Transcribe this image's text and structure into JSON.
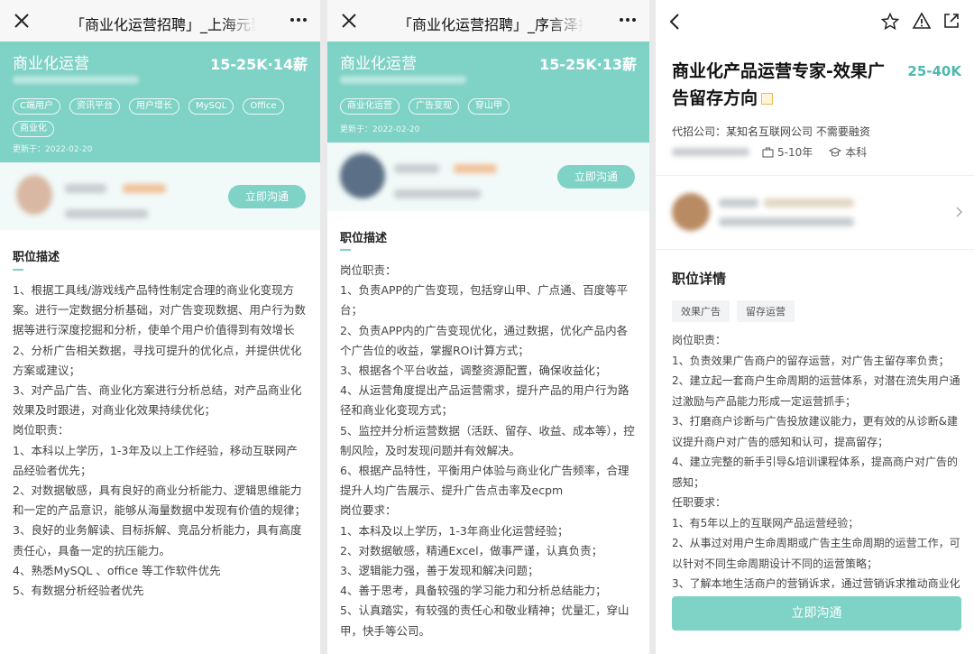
{
  "colors": {
    "accent": "#7fd2c6",
    "accent_text": "#4fb9ad"
  },
  "panel1": {
    "nav_title": "「商业化运营招聘」_上海元聚推",
    "job_title": "商业化运营",
    "salary": "15-25K·14薪",
    "tags": [
      "C端用户",
      "资讯平台",
      "用户增长",
      "MySQL",
      "Office",
      "商业化"
    ],
    "updated": "更新于：2022-02-20",
    "chat_label": "立即沟通",
    "section_title": "职位描述",
    "desc": [
      "1、根据工具线/游戏线产品特性制定合理的商业化变现方案。进行一定数据分析基础，对广告变现数据、用户行为数据等进行深度挖掘和分析，使单个用户价值得到有效增长",
      "2、分析广告相关数据，寻找可提升的优化点，并提供优化方案或建议；",
      "3、对产品广告、商业化方案进行分析总结，对产品商业化效果及时跟进，对商业化效果持续优化；",
      "岗位职责：",
      "1、本科以上学历，1-3年及以上工作经验，移动互联网产品经验者优先；",
      "2、对数据敏感，具有良好的商业分析能力、逻辑思维能力和一定的产品意识，能够从海量数据中发现有价值的规律；",
      "3、良好的业务解读、目标拆解、竞品分析能力，具有高度责任心，具备一定的抗压能力。",
      "4、熟悉MySQL 、office 等工作软件优先",
      "5、有数据分析经验者优先"
    ]
  },
  "panel2": {
    "nav_title": "「商业化运营招聘」_序言泽招聘",
    "job_title": "商业化运营",
    "salary": "15-25K·13薪",
    "tags": [
      "商业化运营",
      "广告变现",
      "穿山甲"
    ],
    "updated": "更新于：2022-02-20",
    "chat_label": "立即沟通",
    "section_title": "职位描述",
    "desc": [
      "岗位职责：",
      "1、负责APP的广告变现，包括穿山甲、广点通、百度等平台；",
      "2、负责APP内的广告变现优化，通过数据，优化产品内各个广告位的收益，掌握ROI计算方式；",
      "3、根据各个平台收益，调整资源配置，确保收益化；",
      "4、从运营角度提出产品运营需求，提升产品的用户行为路径和商业化变现方式；",
      "5、监控并分析运营数据（活跃、留存、收益、成本等），控制风险，及时发现问题并有效解决。",
      "6、根据产品特性，平衡用户体验与商业化广告频率，合理提升人均广告展示、提升广告点击率及ecpm",
      "岗位要求：",
      "1、本科及以上学历，1-3年商业化运营经验；",
      "2、对数据敏感，精通Excel，做事严谨，认真负责；",
      "3、逻辑能力强，善于发现和解决问题；",
      "4、善于思考，具备较强的学习能力和分析总结能力；",
      "5、认真踏实，有较强的责任心和敬业精神；优量汇，穿山甲，快手等公司。"
    ]
  },
  "panel3": {
    "job_title": "商业化产品运营专家-效果广告留存方向",
    "salary": "25-40K",
    "company": "代招公司：某知名互联网公司  不需要融资",
    "experience": "5-10年",
    "education": "本科",
    "section_title": "职位详情",
    "tags": [
      "效果广告",
      "留存运营"
    ],
    "desc": [
      "岗位职责：",
      "1、负责效果广告商户的留存运营，对广告主留存率负责；",
      "2、建立起一套商户生命周期的运营体系，对潜在流失用户通过激励与产品能力形成一定运营抓手；",
      "3、打磨商户诊断与广告投放建议能力，更有效的从诊断&建议提升商户对广告的感知和认可，提高留存；",
      "4、建立完整的新手引导&培训课程体系，提高商户对广告的感知；",
      "任职要求：",
      "1、有5年以上的互联网产品运营经验；",
      "2、从事过对用户生命周期或广告主生命周期的运营工作，可以针对不同生命周期设计不同的运营策略；",
      "3、了解本地生活商户的营销诉求，通过营销诉求推动商业化"
    ],
    "cta": "立即沟通"
  }
}
